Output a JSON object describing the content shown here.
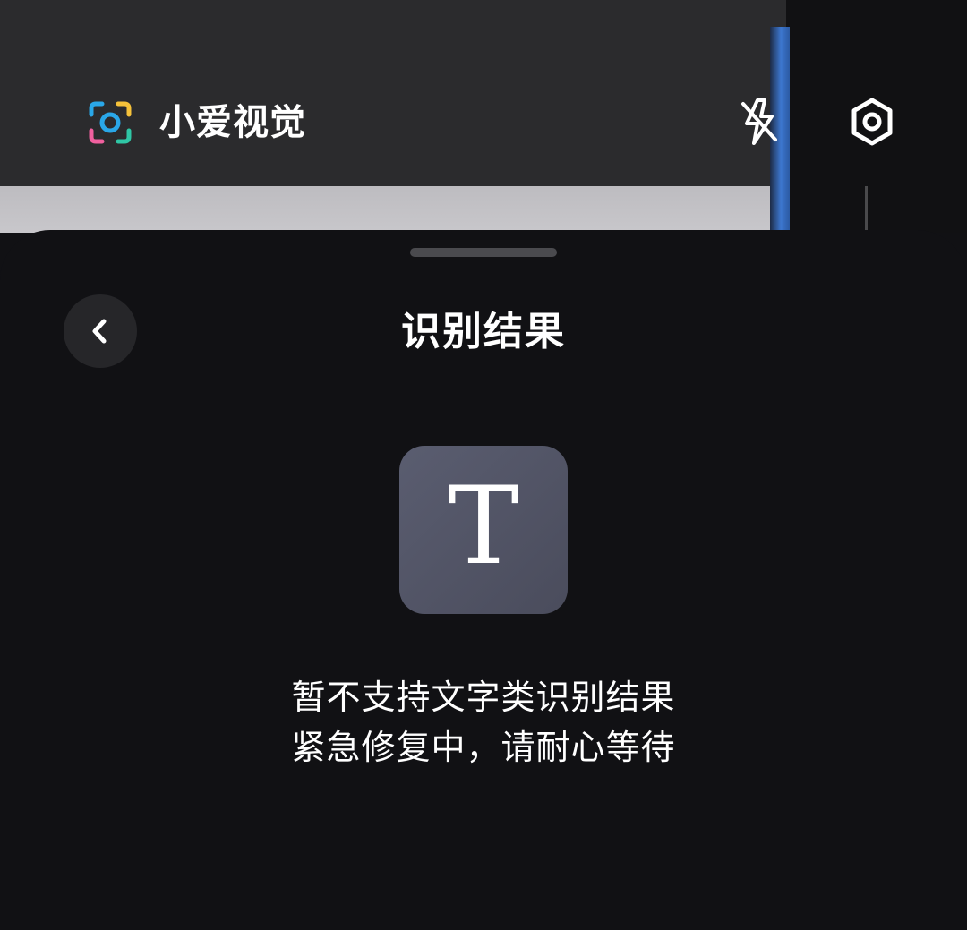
{
  "topbar": {
    "app_title": "小爱视觉",
    "logo_icon": "camera-scan-icon",
    "flash_icon": "flash-off-icon",
    "settings_icon": "settings-hexagon-icon"
  },
  "sheet": {
    "title": "识别结果",
    "back_icon": "chevron-left-icon",
    "result_type_icon": "text-type-icon",
    "result_type_glyph": "T",
    "message_line1": "暂不支持文字类识别结果",
    "message_line2": "紧急修复中，请耐心等待"
  },
  "colors": {
    "sheet_background": "#111114",
    "icon_tile": "#53566a",
    "logo_blue": "#2aa7e8",
    "logo_pink": "#f0609e",
    "logo_yellow": "#f6c23a",
    "logo_green": "#2fc6a5"
  }
}
